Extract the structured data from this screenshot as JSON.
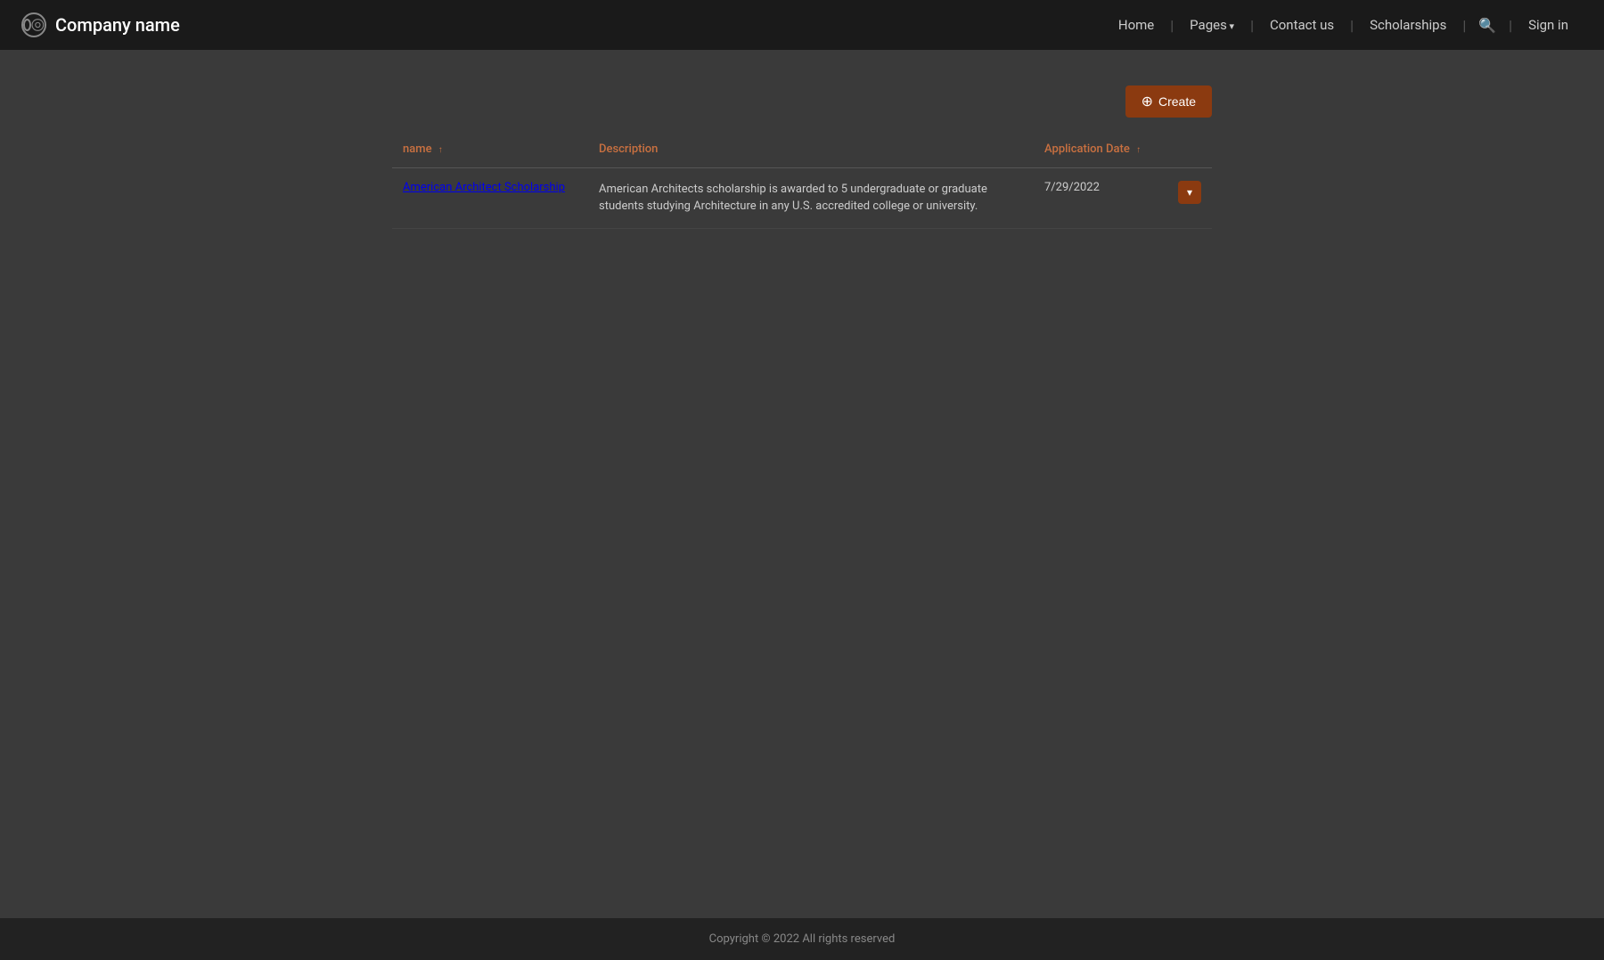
{
  "brand": {
    "name": "Company name"
  },
  "navbar": {
    "home_label": "Home",
    "pages_label": "Pages",
    "contact_label": "Contact us",
    "scholarships_label": "Scholarships",
    "signin_label": "Sign in"
  },
  "toolbar": {
    "create_label": "Create",
    "create_icon": "⊕"
  },
  "table": {
    "columns": [
      {
        "key": "name",
        "label": "name"
      },
      {
        "key": "description",
        "label": "Description"
      },
      {
        "key": "date",
        "label": "Application Date"
      }
    ],
    "rows": [
      {
        "name": "American Architect Scholarship",
        "description": "American Architects scholarship is awarded to 5 undergraduate or graduate students studying Architecture in any U.S. accredited college or university.",
        "date": "7/29/2022"
      }
    ],
    "action_dropdown_label": "▾"
  },
  "footer": {
    "copyright": "Copyright © 2022  All rights reserved"
  }
}
